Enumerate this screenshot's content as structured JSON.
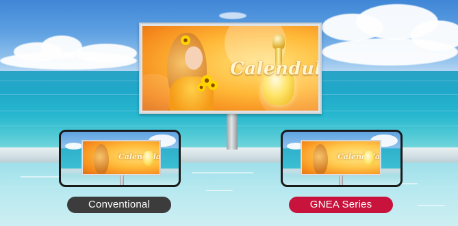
{
  "billboard": {
    "brand_text": "Calendula"
  },
  "comparison": {
    "left_label": "Conventional",
    "right_label": "GNEA Series"
  },
  "colors": {
    "conventional_pill": "#3c3c3c",
    "gnea_pill": "#c8143c",
    "sea": "#27b7cf",
    "sky": "#5fa1e2"
  }
}
